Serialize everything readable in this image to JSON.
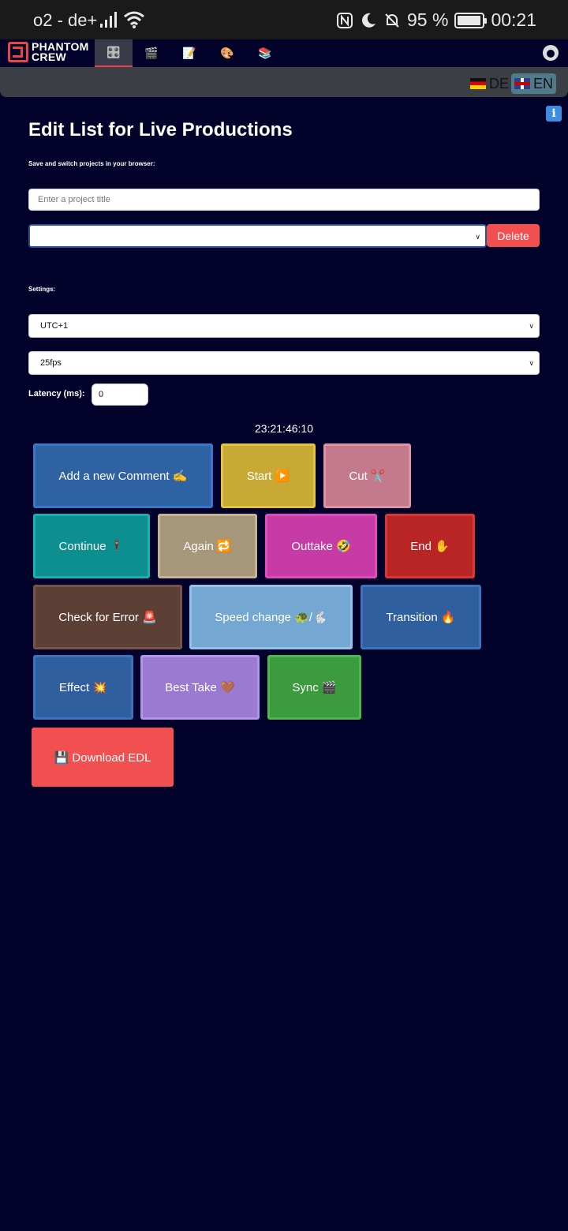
{
  "statusbar": {
    "carrier": "o2 - de+",
    "battery": "95 %",
    "time": "00:21",
    "battery_level": 0.95,
    "icons": [
      "signal-icon",
      "wifi-icon",
      "nfc-icon",
      "moon-icon",
      "mute-bell-icon",
      "battery-icon"
    ]
  },
  "nav": {
    "logo_line1": "PHANTOM",
    "logo_line2": "CREW",
    "tabs": [
      {
        "icon": "🎛️",
        "name": "control-knobs-icon"
      },
      {
        "icon": "🎬",
        "name": "clapper-icon"
      },
      {
        "icon": "📝",
        "name": "memo-icon"
      },
      {
        "icon": "🎨",
        "name": "palette-icon"
      },
      {
        "icon": "📚",
        "name": "books-icon"
      }
    ]
  },
  "lang": {
    "de": "DE",
    "en": "EN"
  },
  "info_icon": "i",
  "page": {
    "title": "Edit List for Live Productions",
    "subtitle": "Save and switch projects in your browser:",
    "title_placeholder": "Enter a project title",
    "project_selected": "",
    "delete_label": "Delete",
    "settings_label": "Settings:",
    "timezone": "UTC+1",
    "fps": "25fps",
    "latency_label": "Latency (ms):",
    "latency_value": "0",
    "timecode": "23:21:46:10"
  },
  "buttons": [
    {
      "label": "Add a new Comment ✍️",
      "bg": "#2f62a3",
      "border": "#3a78c7"
    },
    {
      "label": "Start ▶️",
      "bg": "#c9a936",
      "border": "#e3c24a"
    },
    {
      "label": "Cut ✂️",
      "bg": "#c27a8c",
      "border": "#dc93a5"
    },
    {
      "label": "Continue 🕴️",
      "bg": "#0e8f8f",
      "border": "#18b0b0"
    },
    {
      "label": "Again 🔁",
      "bg": "#a6967a",
      "border": "#c6b494"
    },
    {
      "label": "Outtake 🤣",
      "bg": "#c63ba6",
      "border": "#e04bbe"
    },
    {
      "label": "End ✋",
      "bg": "#b92525",
      "border": "#d83636"
    },
    {
      "label": "Check for Error 🚨",
      "bg": "#5c4036",
      "border": "#775447"
    },
    {
      "label": "Speed change 🐢/🐇",
      "bg": "#74a7d2",
      "border": "#95c2ea"
    },
    {
      "label": "Transition 🔥",
      "bg": "#2f5f9e",
      "border": "#3b73bd"
    },
    {
      "label": "Effect 💥",
      "bg": "#2f5f9e",
      "border": "#3b73bd"
    },
    {
      "label": "Best Take 🤎",
      "bg": "#9a7bd1",
      "border": "#b294ea"
    },
    {
      "label": "Sync 🎬",
      "bg": "#3c9a3f",
      "border": "#4cb84f"
    }
  ],
  "download_label": "💾 Download EDL"
}
